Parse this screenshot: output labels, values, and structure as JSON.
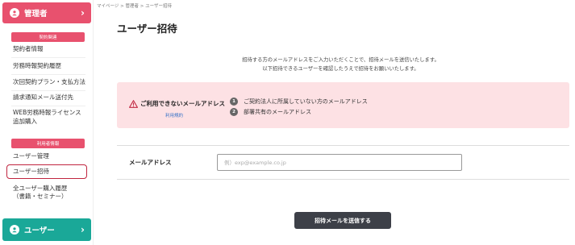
{
  "breadcrumb": "マイページ > 管理者 > ユーザー招待",
  "sidebar": {
    "admin_label": "管理者",
    "section_contract": "契約関連",
    "contract_items": [
      "契約者情報",
      "労務時報契約履歴",
      "次回契約プラン・支払方法",
      "請求通知メール送付先",
      "WEB労務時報ライセンス",
      "追加購入"
    ],
    "section_users": "利用者情報",
    "user_items": [
      "ユーザー管理",
      "ユーザー招待",
      "全ユーザー購入履歴",
      "（書籍・セミナー）"
    ],
    "user_footer_label": "ユーザー",
    "chevron": "›",
    "accent_color": "#e8516e",
    "footer_color": "#1aa898"
  },
  "main": {
    "title": "ユーザー招待",
    "intro_line1": "招待する方のメールアドレスをご入力いただくことで、招待メールを送信いたします。",
    "intro_line2": "以下招待できるユーザーを確認したうえで招待をお願いいたします。",
    "warning": {
      "title": "ご利用できないメールアドレス",
      "terms_link": "利用規約",
      "items": [
        {
          "num": "1",
          "text": "ご契約法人に所属していない方のメールアドレス"
        },
        {
          "num": "2",
          "text": "部署共有のメールアドレス"
        }
      ]
    },
    "email_label": "メールアドレス",
    "email_placeholder": "例）exp@example.co.jp",
    "submit_label": "招待メールを送信する"
  }
}
